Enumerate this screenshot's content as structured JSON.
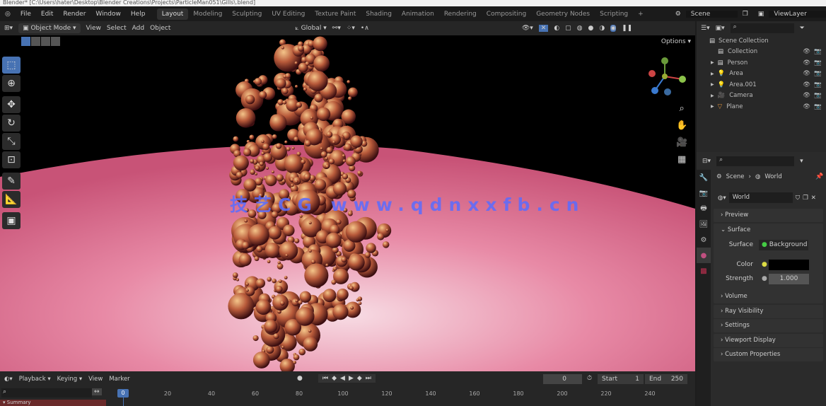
{
  "title_bar": "Blender* [C:\\Users\\hater\\Desktop\\Blender Creations\\Projects\\ParticleMan051\\Gills\\.blend]",
  "menu": [
    "File",
    "Edit",
    "Render",
    "Window",
    "Help"
  ],
  "workspaces": [
    "Layout",
    "Modeling",
    "Sculpting",
    "UV Editing",
    "Texture Paint",
    "Shading",
    "Animation",
    "Rendering",
    "Compositing",
    "Geometry Nodes",
    "Scripting"
  ],
  "active_workspace": "Layout",
  "scene": "Scene",
  "view_layer": "ViewLayer",
  "header": {
    "mode": "Object Mode",
    "view": "View",
    "select": "Select",
    "add": "Add",
    "object": "Object",
    "orientation": "Global",
    "options": "Options"
  },
  "watermark": "技艺CG www.qdnxxfb.cn",
  "outliner": {
    "root": "Scene Collection",
    "items": [
      {
        "name": "Collection",
        "icon": "collection-icon"
      },
      {
        "name": "Person",
        "icon": "collection-icon"
      },
      {
        "name": "Area",
        "icon": "light-icon"
      },
      {
        "name": "Area.001",
        "icon": "light-icon"
      },
      {
        "name": "Camera",
        "icon": "camera-icon"
      },
      {
        "name": "Plane",
        "icon": "mesh-icon"
      }
    ]
  },
  "properties": {
    "breadcrumb_scene": "Scene",
    "breadcrumb_world": "World",
    "world_name": "World",
    "panels": [
      "Preview",
      "Surface",
      "Volume",
      "Ray Visibility",
      "Settings",
      "Viewport Display",
      "Custom Properties"
    ],
    "surface_label": "Surface",
    "surface_value": "Background",
    "color_label": "Color",
    "color_value": "#000000",
    "strength_label": "Strength",
    "strength_value": "1.000"
  },
  "timeline": {
    "playback": "Playback",
    "keying": "Keying",
    "view": "View",
    "marker": "Marker",
    "current_frame": "0",
    "start_label": "Start",
    "start": "1",
    "end_label": "End",
    "end": "250",
    "ticks": [
      "0",
      "20",
      "40",
      "60",
      "80",
      "100",
      "120",
      "140",
      "160",
      "180",
      "200",
      "220",
      "240"
    ],
    "summary": "Summary"
  },
  "colors": {
    "accent": "#4772b3",
    "floor": "#e07a9a"
  }
}
